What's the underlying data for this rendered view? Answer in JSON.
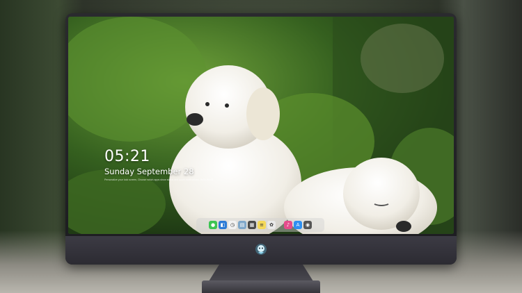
{
  "lock_screen": {
    "time": "05:21",
    "date": "Sunday September  28",
    "notice": "Personalize your lock screen, Choose which apps show status and quick notifications. Hello World"
  },
  "colors": {
    "wallpaper_foliage": "#3d6b2a",
    "monitor_bezel": "#1c1c20",
    "chin": "#3c3b44",
    "dock_background": "rgba(210,210,210,0.45)"
  },
  "dock": {
    "icons": [
      {
        "name": "messages-icon",
        "color": "#3cc453",
        "glyph": "●"
      },
      {
        "name": "finder-icon",
        "color": "#2c7bd6",
        "glyph": "◧"
      },
      {
        "name": "clock-icon",
        "color": "#f2f2f2",
        "glyph": "◷"
      },
      {
        "name": "preview-icon",
        "color": "#7fa7c9",
        "glyph": "▤"
      },
      {
        "name": "movie-icon",
        "color": "#4a4a4a",
        "glyph": "▦"
      },
      {
        "name": "notes-icon",
        "color": "#f5d95a",
        "glyph": "≡"
      },
      {
        "name": "photos-icon",
        "color": "#e9e9e9",
        "glyph": "✿"
      },
      {
        "name": "music-icon",
        "color": "#e64c8c",
        "glyph": "♪"
      },
      {
        "name": "app-store-icon",
        "color": "#2f8ff0",
        "glyph": "A"
      },
      {
        "name": "camera-icon",
        "color": "#555555",
        "glyph": "◉"
      }
    ]
  }
}
